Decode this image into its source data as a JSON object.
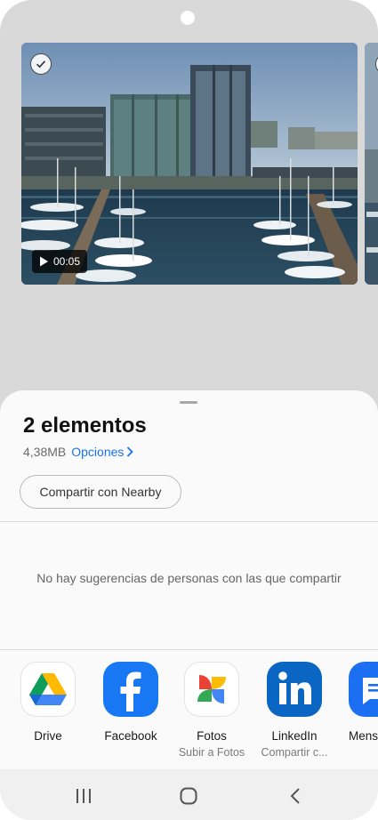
{
  "media": {
    "duration": "00:05"
  },
  "sheet": {
    "title": "2 elementos",
    "size": "4,38MB",
    "options_label": "Opciones",
    "nearby_label": "Compartir con Nearby",
    "no_suggestions": "No hay sugerencias de personas con las que compartir"
  },
  "apps": [
    {
      "label": "Drive",
      "sub": "",
      "icon": "google-drive-icon"
    },
    {
      "label": "Facebook",
      "sub": "",
      "icon": "facebook-icon"
    },
    {
      "label": "Fotos",
      "sub": "Subir a Fotos",
      "icon": "google-photos-icon"
    },
    {
      "label": "LinkedIn",
      "sub": "Compartir c...",
      "icon": "linkedin-icon"
    },
    {
      "label": "Mens",
      "sub": "",
      "icon": "messages-icon"
    }
  ],
  "nav": {
    "recent_icon": "recent-apps-icon",
    "home_icon": "home-icon",
    "back_icon": "back-icon"
  },
  "colors": {
    "accent": "#1a73e8",
    "facebook": "#1877f2",
    "linkedin": "#0a66c2",
    "sheet_bg": "#fafafa",
    "backdrop": "#d9d9d9"
  }
}
